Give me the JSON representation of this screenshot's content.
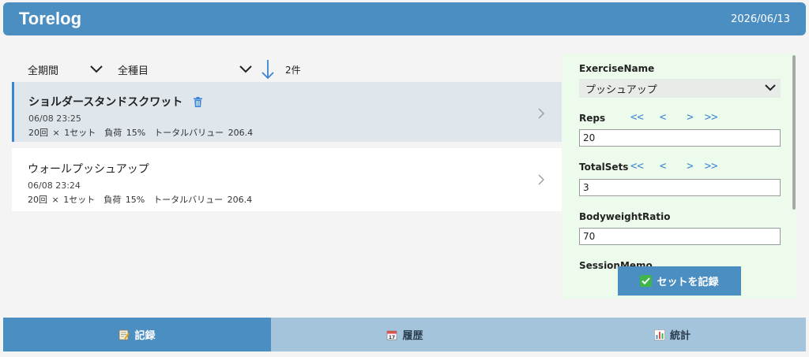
{
  "header": {
    "title": "Torelog",
    "date": "2026/06/13"
  },
  "filters": {
    "period": "全期間",
    "type": "全種目",
    "count": "2件"
  },
  "entries": [
    {
      "title": "ショルダースタンドスクワット",
      "time": "06/08 23:25",
      "detail": "20回 × 1セット　負荷 15%　トータルバリュー 206.4"
    },
    {
      "title": "ウォールプッシュアップ",
      "time": "06/08 23:24",
      "detail": "20回 × 1セット　負荷 15%　トータルバリュー 206.4"
    }
  ],
  "form": {
    "exercise_label": "ExerciseName",
    "exercise_value": "プッシュアップ",
    "reps_label": "Reps",
    "reps_value": "20",
    "sets_label": "TotalSets",
    "sets_value": "3",
    "bw_label": "BodyweightRatio",
    "bw_value": "70",
    "memo_label": "SessionMemo",
    "stepper": {
      "dec_big": "<<",
      "dec": "<",
      "inc": ">",
      "inc_big": ">>"
    },
    "submit": "セットを記録"
  },
  "nav": {
    "record": "記録",
    "history": "履歴",
    "stats": "統計"
  },
  "colors": {
    "primary": "#4a8ec2",
    "nav_inactive": "#a3c4db",
    "panel_bg": "#edfbec",
    "accent": "#3a86d4"
  }
}
